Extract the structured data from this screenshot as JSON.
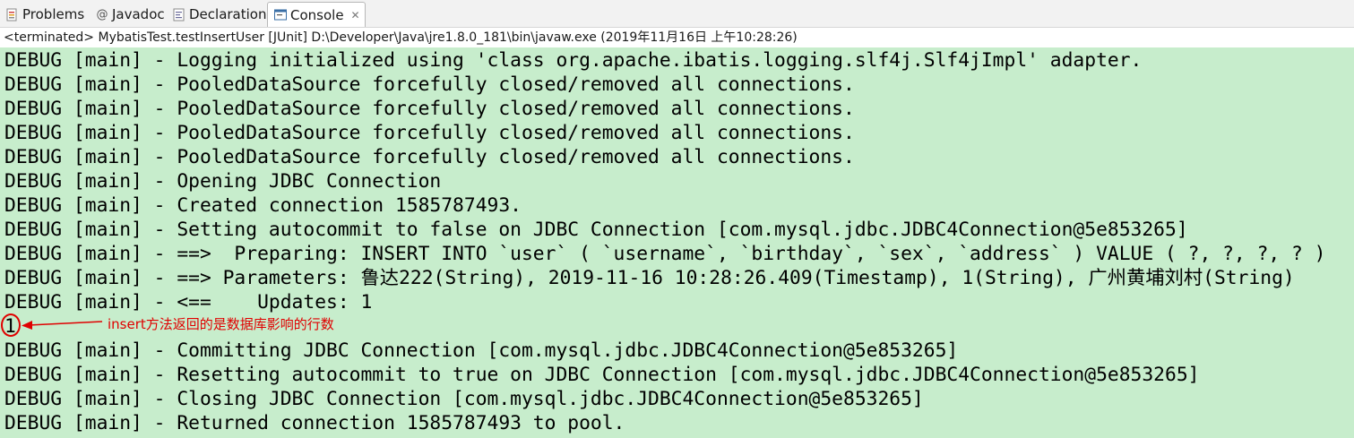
{
  "tabs": [
    {
      "label": "Problems",
      "icon": "problems-icon"
    },
    {
      "label": "Javadoc",
      "icon": "at-icon"
    },
    {
      "label": "Declaration",
      "icon": "declaration-icon"
    },
    {
      "label": "Console",
      "icon": "console-icon",
      "close": "✕"
    }
  ],
  "status_line": "<terminated> MybatisTest.testInsertUser [JUnit] D:\\Developer\\Java\\jre1.8.0_181\\bin\\javaw.exe (2019年11月16日 上午10:28:26)",
  "console_lines": [
    "DEBUG [main] - Logging initialized using 'class org.apache.ibatis.logging.slf4j.Slf4jImpl' adapter.",
    "DEBUG [main] - PooledDataSource forcefully closed/removed all connections.",
    "DEBUG [main] - PooledDataSource forcefully closed/removed all connections.",
    "DEBUG [main] - PooledDataSource forcefully closed/removed all connections.",
    "DEBUG [main] - PooledDataSource forcefully closed/removed all connections.",
    "DEBUG [main] - Opening JDBC Connection",
    "DEBUG [main] - Created connection 1585787493.",
    "DEBUG [main] - Setting autocommit to false on JDBC Connection [com.mysql.jdbc.JDBC4Connection@5e853265]",
    "DEBUG [main] - ==>  Preparing: INSERT INTO `user` ( `username`, `birthday`, `sex`, `address` ) VALUE ( ?, ?, ?, ? )",
    "DEBUG [main] - ==> Parameters: 鲁达222(String), 2019-11-16 10:28:26.409(Timestamp), 1(String), 广州黄埔刘村(String)",
    "DEBUG [main] - <==    Updates: 1",
    "1",
    "DEBUG [main] - Committing JDBC Connection [com.mysql.jdbc.JDBC4Connection@5e853265]",
    "DEBUG [main] - Resetting autocommit to true on JDBC Connection [com.mysql.jdbc.JDBC4Connection@5e853265]",
    "DEBUG [main] - Closing JDBC Connection [com.mysql.jdbc.JDBC4Connection@5e853265]",
    "DEBUG [main] - Returned connection 1585787493 to pool."
  ],
  "annotation": "insert方法返回的是数据库影响的行数",
  "colors": {
    "console_bg": "#c7edcc",
    "annotation": "#e00000"
  }
}
